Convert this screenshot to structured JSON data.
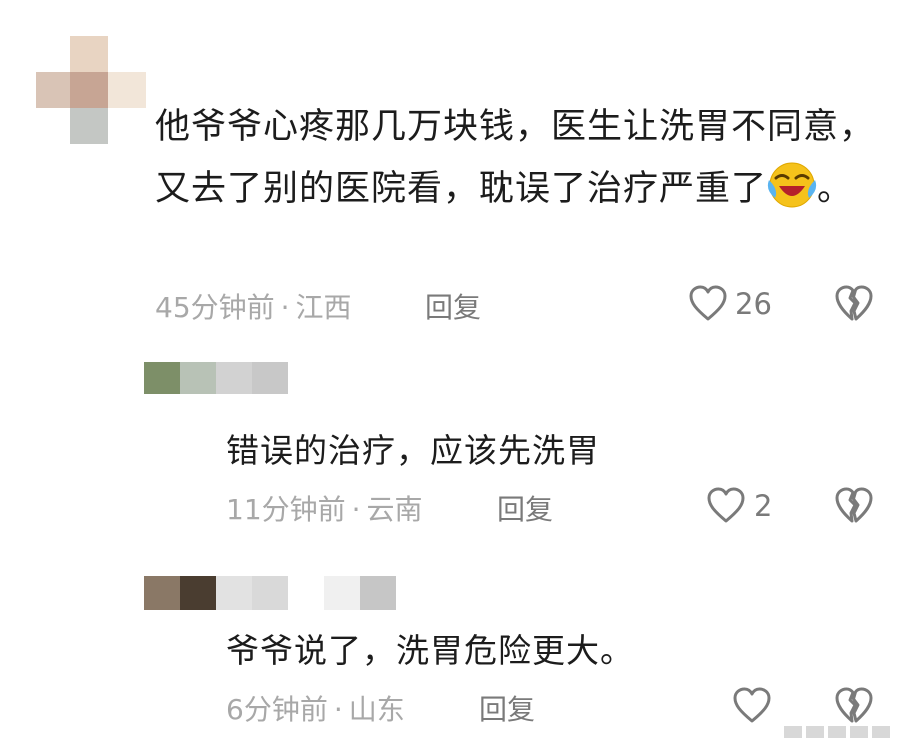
{
  "comments": [
    {
      "text_before_emoji": "他爷爷心疼那几万块钱，医生让洗胃不同意，又去了别的医院看，耽误了治疗严重了",
      "text_after_emoji": "。",
      "emoji": "crying-laughing-emoji",
      "time": "45分钟前",
      "separator": "·",
      "location": "江西",
      "reply_label": "回复",
      "likes": "26"
    },
    {
      "text": "错误的治疗，应该先洗胃",
      "time": "11分钟前",
      "separator": "·",
      "location": "云南",
      "reply_label": "回复",
      "likes": "2"
    },
    {
      "text": "爷爷说了，洗胃危险更大。",
      "time": "6分钟前",
      "separator": "·",
      "location": "山东",
      "reply_label": "回复"
    }
  ],
  "icons": {
    "like": "heart-outline-icon",
    "dislike": "broken-heart-icon"
  },
  "colors": {
    "text": "#1c1c1c",
    "meta": "#a8a8a8",
    "action": "#7a7a7a"
  }
}
